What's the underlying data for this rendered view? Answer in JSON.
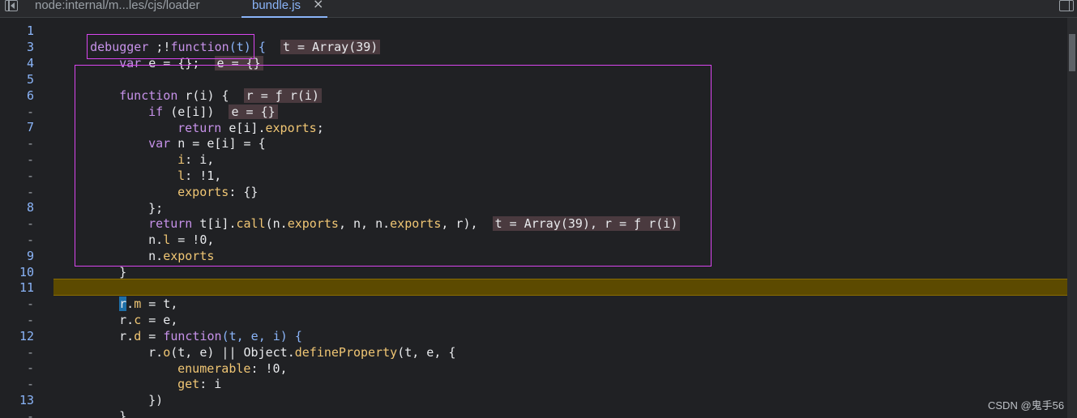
{
  "tabs": [
    {
      "label": "node:internal/m...les/cjs/loader"
    },
    {
      "label": "bundle.js",
      "close": "×"
    }
  ],
  "watermark": "CSDN @鬼手56",
  "gutter": [
    "1",
    "3",
    "4",
    "5",
    "6",
    "-",
    "7",
    "-",
    "-",
    "-",
    "-",
    "8",
    "-",
    "-",
    "9",
    "10",
    "11",
    "-",
    "-",
    "12",
    "-",
    "-",
    "-",
    "13",
    "-"
  ],
  "code": {
    "l1_a": "debugger",
    "l1_b": " ;!",
    "l1_c": "function",
    "l1_d": "(t) {",
    "l1_inline": "t = Array(39)",
    "l3_a": "var",
    "l3_b": " e = {};",
    "l3_inline": "e = {}",
    "l5_a": "function",
    "l5_b": " r(i) {",
    "l5_inline": "r = ƒ r(i)",
    "l6_a": "if",
    "l6_b": " (e[i])",
    "l6_inline": "e = {}",
    "l6b_a": "return",
    "l6b_b": " e[i].",
    "l6b_c": "exports",
    "l6b_d": ";",
    "l7_a": "var",
    "l7_b": " n = e[i] = {",
    "l7b_a": "i",
    "l7b_b": ": i,",
    "l7c_a": "l",
    "l7c_b": ": !1,",
    "l7d_a": "exports",
    "l7d_b": ": {}",
    "l7e": "};",
    "l8_a": "return",
    "l8_b": " t[i].",
    "l8_c": "call",
    "l8_d": "(n.",
    "l8_e": "exports",
    "l8_f": ", n, n.",
    "l8_g": "exports",
    "l8_h": ", r),",
    "l8_inline": "t = Array(39), r = ƒ r(i)",
    "l8b_a": "n.",
    "l8b_b": "l",
    "l8b_c": " = !0,",
    "l8c_a": "n.",
    "l8c_b": "exports",
    "l9": "}",
    "l11_a": "r",
    "l11_b": ".",
    "l11_c": "m",
    "l11_d": " = t,",
    "l11b_a": "r.",
    "l11b_b": "c",
    "l11b_c": " = e,",
    "l11c_a": "r.",
    "l11c_b": "d",
    "l11c_c": " = ",
    "l11c_d": "function",
    "l11c_e": "(t, e, i) {",
    "l12_a": "r.",
    "l12_b": "o",
    "l12_c": "(t, e) || Object.",
    "l12_d": "defineProperty",
    "l12_e": "(t, e, {",
    "l12b_a": "enumerable",
    "l12b_b": ": !0,",
    "l12c_a": "get",
    "l12c_b": ": i",
    "l12d": "})",
    "l13": "}"
  },
  "colors": {
    "background": "#202124",
    "keyword": "#c792ea",
    "property": "#f0c674",
    "line_number": "#8ab4f8",
    "execution_line": "#5c4a00",
    "highlight_box": "#d946ef",
    "inline_value_bg": "#4a3a3f"
  }
}
